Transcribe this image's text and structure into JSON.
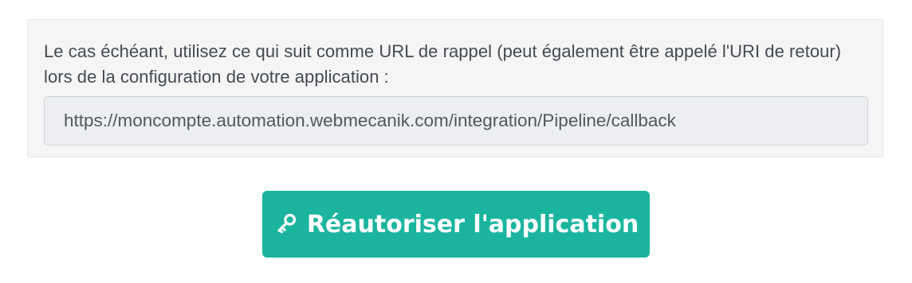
{
  "callback_panel": {
    "help_text": "Le cas échéant, utilisez ce qui suit comme URL de rappel (peut également être appelé l'URI de retour) lors de la configuration de votre application :",
    "callback_url": "https://moncompte.automation.webmecanik.com/integration/Pipeline/callback"
  },
  "actions": {
    "reauthorize_label": "Réautoriser l'application",
    "reauthorize_icon": "key-icon"
  },
  "colors": {
    "accent": "#1bb59f",
    "panel_background": "#f5f5f5",
    "field_background": "#eceef1",
    "text": "#444a52"
  }
}
